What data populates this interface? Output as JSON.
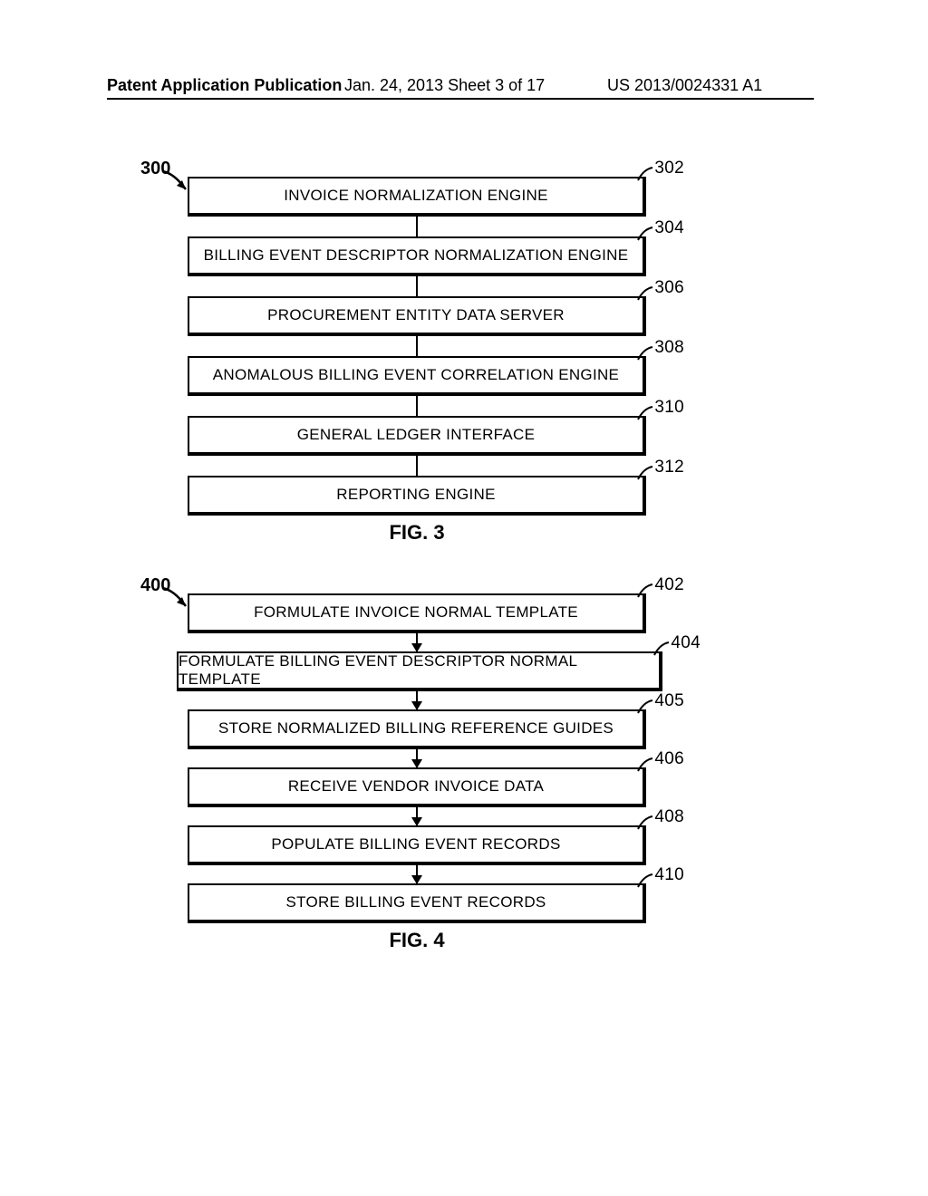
{
  "header": {
    "left": "Patent Application Publication",
    "center": "Jan. 24, 2013  Sheet 3 of 17",
    "right": "US 2013/0024331 A1"
  },
  "fig3": {
    "ref": "300",
    "caption": "FIG. 3",
    "steps": [
      {
        "num": "302",
        "label": "INVOICE NORMALIZATION ENGINE"
      },
      {
        "num": "304",
        "label": "BILLING EVENT DESCRIPTOR NORMALIZATION ENGINE"
      },
      {
        "num": "306",
        "label": "PROCUREMENT ENTITY DATA SERVER"
      },
      {
        "num": "308",
        "label": "ANOMALOUS BILLING EVENT CORRELATION ENGINE"
      },
      {
        "num": "310",
        "label": "GENERAL LEDGER INTERFACE"
      },
      {
        "num": "312",
        "label": "REPORTING ENGINE"
      }
    ]
  },
  "fig4": {
    "ref": "400",
    "caption": "FIG. 4",
    "steps": [
      {
        "num": "402",
        "label": "FORMULATE INVOICE NORMAL TEMPLATE"
      },
      {
        "num": "404",
        "label": "FORMULATE BILLING EVENT DESCRIPTOR NORMAL TEMPLATE"
      },
      {
        "num": "405",
        "label": "STORE NORMALIZED BILLING REFERENCE GUIDES"
      },
      {
        "num": "406",
        "label": "RECEIVE VENDOR INVOICE DATA"
      },
      {
        "num": "408",
        "label": "POPULATE BILLING EVENT RECORDS"
      },
      {
        "num": "410",
        "label": "STORE BILLING EVENT RECORDS"
      }
    ]
  }
}
